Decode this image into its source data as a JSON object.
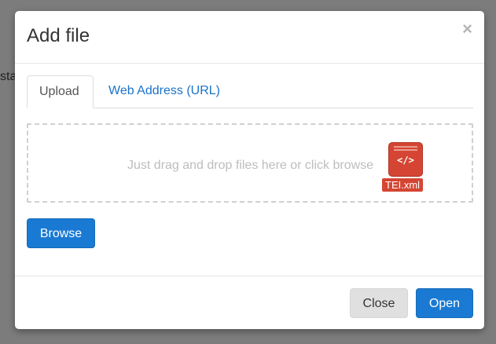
{
  "backdrop": {
    "text": "sta"
  },
  "dialog": {
    "title": "Add file",
    "close_glyph": "×",
    "tabs": [
      {
        "label": "Upload",
        "active": true
      },
      {
        "label": "Web Address (URL)",
        "active": false
      }
    ],
    "dropzone": {
      "text": "Just drag and drop files here or click browse",
      "file": {
        "icon": "code-file-icon",
        "icon_glyph": "</>",
        "name": "TEI.xml"
      }
    },
    "browse_label": "Browse",
    "footer": {
      "close_label": "Close",
      "open_label": "Open"
    }
  },
  "colors": {
    "primary": "#1a7ad3",
    "link": "#1a73c9",
    "file_badge": "#d44633",
    "backdrop": "#7c7c7c"
  }
}
